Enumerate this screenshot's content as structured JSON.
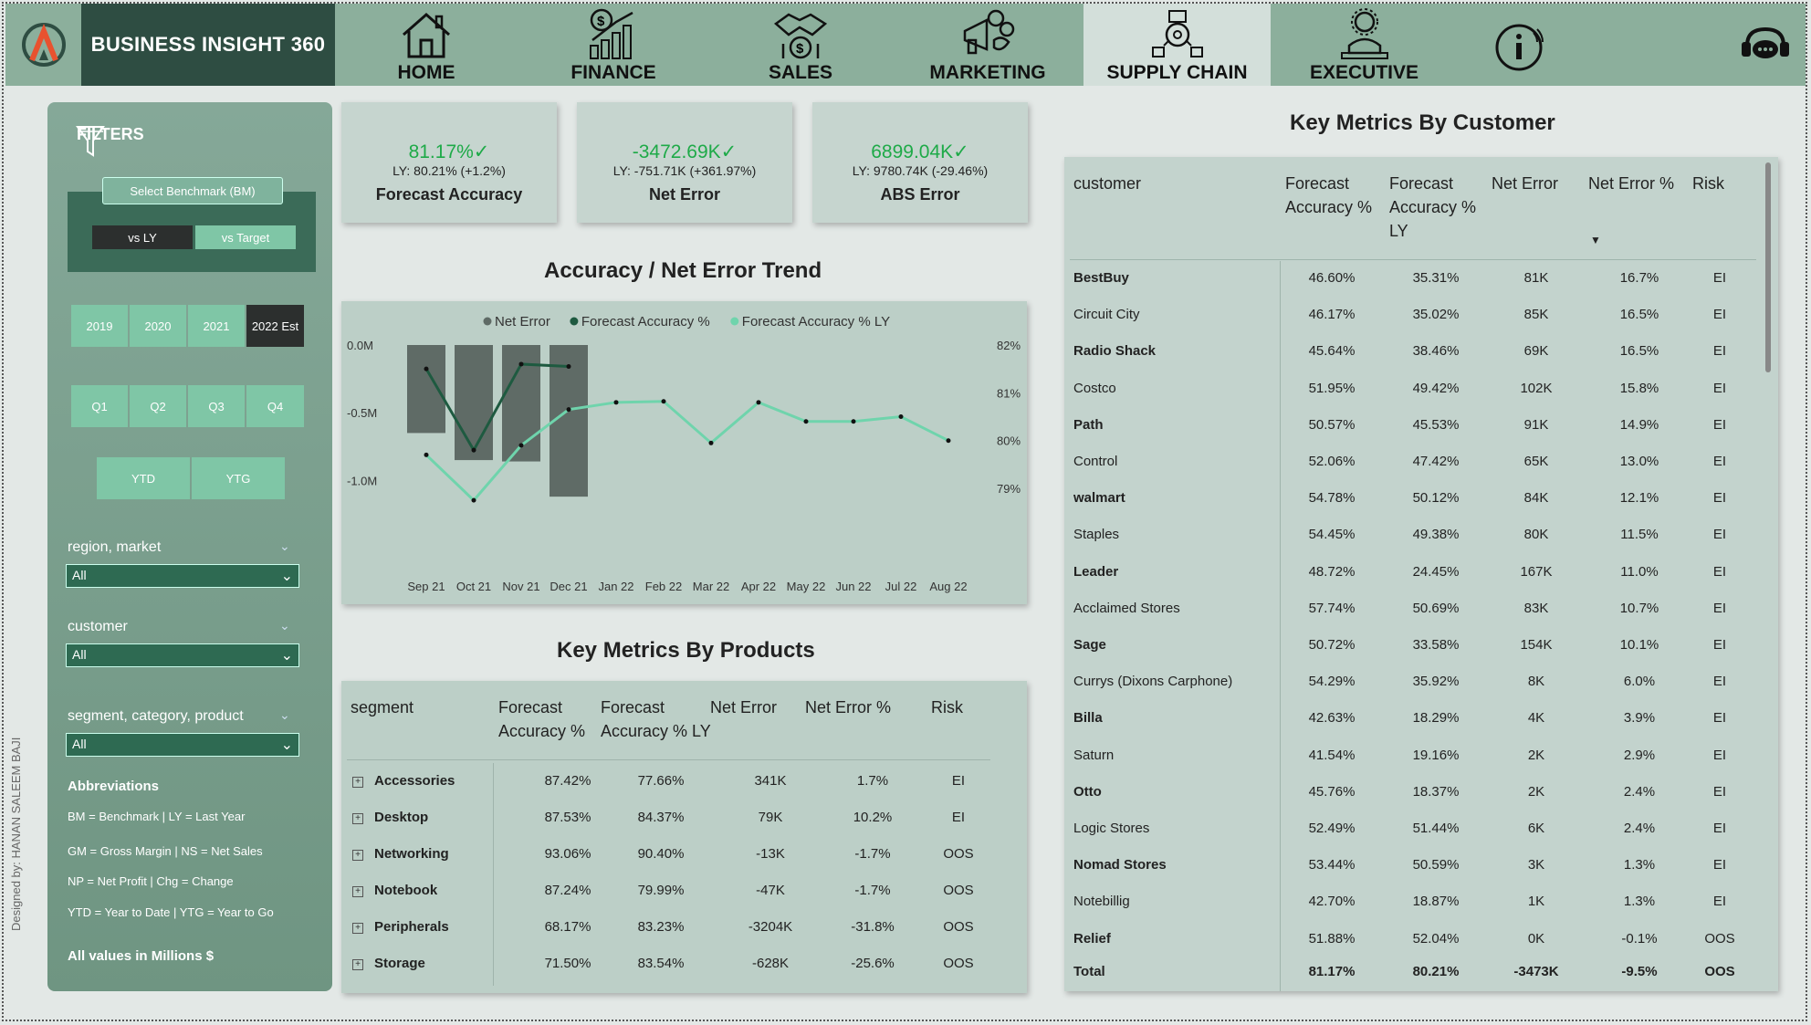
{
  "header": {
    "brand": "BUSINESS INSIGHT 360",
    "nav": [
      {
        "label": "HOME",
        "icon": "home-icon"
      },
      {
        "label": "FINANCE",
        "icon": "finance-chart-icon"
      },
      {
        "label": "SALES",
        "icon": "sales-handshake-icon"
      },
      {
        "label": "MARKETING",
        "icon": "marketing-icon"
      },
      {
        "label": "SUPPLY CHAIN",
        "icon": "supply-chain-icon",
        "active": true
      },
      {
        "label": "EXECUTIVE",
        "icon": "executive-icon"
      }
    ],
    "info_icon": "info-icon",
    "support_icon": "support-chat-icon"
  },
  "filters": {
    "title": "FILTERS",
    "benchmark_label": "Select Benchmark (BM)",
    "bm_options": [
      "vs LY",
      "vs Target"
    ],
    "bm_selected": "vs LY",
    "years": [
      "2019",
      "2020",
      "2021",
      "2022 Est"
    ],
    "year_selected": "2022 Est",
    "quarters": [
      "Q1",
      "Q2",
      "Q3",
      "Q4"
    ],
    "ytd": [
      "YTD",
      "YTG"
    ],
    "region_label": "region, market",
    "region_value": "All",
    "customer_label": "customer",
    "customer_value": "All",
    "segment_label": "segment, category, product",
    "segment_value": "All",
    "abbr_title": "Abbreviations",
    "abbreviations": [
      "BM = Benchmark | LY = Last Year",
      "GM = Gross Margin | NS = Net Sales",
      "NP = Net Profit | Chg = Change",
      "YTD = Year to Date | YTG = Year to Go"
    ],
    "all_values": "All values in Millions $",
    "designed_by": "Designed by: HANAN SALEEM BAJI"
  },
  "kpis": [
    {
      "value": "81.17%✓",
      "ly": "LY: 80.21% (+1.2%)",
      "title": "Forecast Accuracy"
    },
    {
      "value": "-3472.69K✓",
      "ly": "LY: -751.71K (+361.97%)",
      "title": "Net Error"
    },
    {
      "value": "6899.04K✓",
      "ly": "LY: 9780.74K (-29.46%)",
      "title": "ABS Error"
    }
  ],
  "colors": {
    "good": "#1eaa48",
    "bar": "#5f6b66",
    "line_dark": "#1e5a40",
    "line_light": "#6fd4ac"
  },
  "trend": {
    "title": "Accuracy / Net Error Trend",
    "chart_data": {
      "type": "bar",
      "categories": [
        "Sep 21",
        "Oct 21",
        "Nov 21",
        "Dec 21",
        "Jan 22",
        "Feb 22",
        "Mar 22",
        "Apr 22",
        "May 22",
        "Jun 22",
        "Jul 22",
        "Aug 22"
      ],
      "series": [
        {
          "name": "Net Error",
          "type": "bar",
          "axis": "left",
          "values": [
            -0.65,
            -0.85,
            -0.86,
            -1.12,
            null,
            null,
            null,
            null,
            null,
            null,
            null,
            null
          ]
        },
        {
          "name": "Forecast Accuracy %",
          "type": "line",
          "axis": "right",
          "values": [
            81.5,
            79.8,
            81.6,
            81.55,
            null,
            null,
            null,
            null,
            null,
            null,
            null,
            null
          ]
        },
        {
          "name": "Forecast Accuracy % LY",
          "type": "line",
          "axis": "right",
          "values": [
            79.7,
            78.75,
            79.9,
            80.65,
            80.8,
            80.82,
            79.95,
            80.8,
            80.4,
            80.4,
            80.5,
            80.0
          ]
        }
      ],
      "left_ticks": [
        "0.0M",
        "-0.5M",
        "-1.0M"
      ],
      "right_ticks": [
        "82%",
        "81%",
        "80%",
        "79%"
      ],
      "ylim_left": [
        -1.2,
        0.0
      ],
      "ylim_right": [
        78.6,
        82.0
      ],
      "legend": "top-center"
    }
  },
  "products": {
    "title": "Key Metrics By Products",
    "columns": [
      "segment",
      "Forecast Accuracy %",
      "Forecast Accuracy % LY",
      "Net Error",
      "Net Error %",
      "Risk"
    ],
    "rows": [
      [
        "Accessories",
        "87.42%",
        "77.66%",
        "341K",
        "1.7%",
        "EI"
      ],
      [
        "Desktop",
        "87.53%",
        "84.37%",
        "79K",
        "10.2%",
        "EI"
      ],
      [
        "Networking",
        "93.06%",
        "90.40%",
        "-13K",
        "-1.7%",
        "OOS"
      ],
      [
        "Notebook",
        "87.24%",
        "79.99%",
        "-47K",
        "-1.7%",
        "OOS"
      ],
      [
        "Peripherals",
        "68.17%",
        "83.23%",
        "-3204K",
        "-31.8%",
        "OOS"
      ],
      [
        "Storage",
        "71.50%",
        "83.54%",
        "-628K",
        "-25.6%",
        "OOS"
      ]
    ]
  },
  "customers": {
    "title": "Key Metrics By Customer",
    "columns": [
      "customer",
      "Forecast Accuracy %",
      "Forecast Accuracy % LY",
      "Net Error",
      "Net Error %",
      "Risk"
    ],
    "rows": [
      [
        "BestBuy",
        "46.60%",
        "35.31%",
        "81K",
        "16.7%",
        "EI"
      ],
      [
        "Circuit City",
        "46.17%",
        "35.02%",
        "85K",
        "16.5%",
        "EI"
      ],
      [
        "Radio Shack",
        "45.64%",
        "38.46%",
        "69K",
        "16.5%",
        "EI"
      ],
      [
        "Costco",
        "51.95%",
        "49.42%",
        "102K",
        "15.8%",
        "EI"
      ],
      [
        "Path",
        "50.57%",
        "45.53%",
        "91K",
        "14.9%",
        "EI"
      ],
      [
        "Control",
        "52.06%",
        "47.42%",
        "65K",
        "13.0%",
        "EI"
      ],
      [
        "walmart",
        "54.78%",
        "50.12%",
        "84K",
        "12.1%",
        "EI"
      ],
      [
        "Staples",
        "54.45%",
        "49.38%",
        "80K",
        "11.5%",
        "EI"
      ],
      [
        "Leader",
        "48.72%",
        "24.45%",
        "167K",
        "11.0%",
        "EI"
      ],
      [
        "Acclaimed Stores",
        "57.74%",
        "50.69%",
        "83K",
        "10.7%",
        "EI"
      ],
      [
        "Sage",
        "50.72%",
        "33.58%",
        "154K",
        "10.1%",
        "EI"
      ],
      [
        "Currys (Dixons Carphone)",
        "54.29%",
        "35.92%",
        "8K",
        "6.0%",
        "EI"
      ],
      [
        "Billa",
        "42.63%",
        "18.29%",
        "4K",
        "3.9%",
        "EI"
      ],
      [
        "Saturn",
        "41.54%",
        "19.16%",
        "2K",
        "2.9%",
        "EI"
      ],
      [
        "Otto",
        "45.76%",
        "18.37%",
        "2K",
        "2.4%",
        "EI"
      ],
      [
        "Logic Stores",
        "52.49%",
        "51.44%",
        "6K",
        "2.4%",
        "EI"
      ],
      [
        "Nomad Stores",
        "53.44%",
        "50.59%",
        "3K",
        "1.3%",
        "EI"
      ],
      [
        "Notebillig",
        "42.70%",
        "18.87%",
        "1K",
        "1.3%",
        "EI"
      ],
      [
        "Relief",
        "51.88%",
        "52.04%",
        "0K",
        "-0.1%",
        "OOS"
      ]
    ],
    "total": [
      "Total",
      "81.17%",
      "80.21%",
      "-3473K",
      "-9.5%",
      "OOS"
    ]
  }
}
